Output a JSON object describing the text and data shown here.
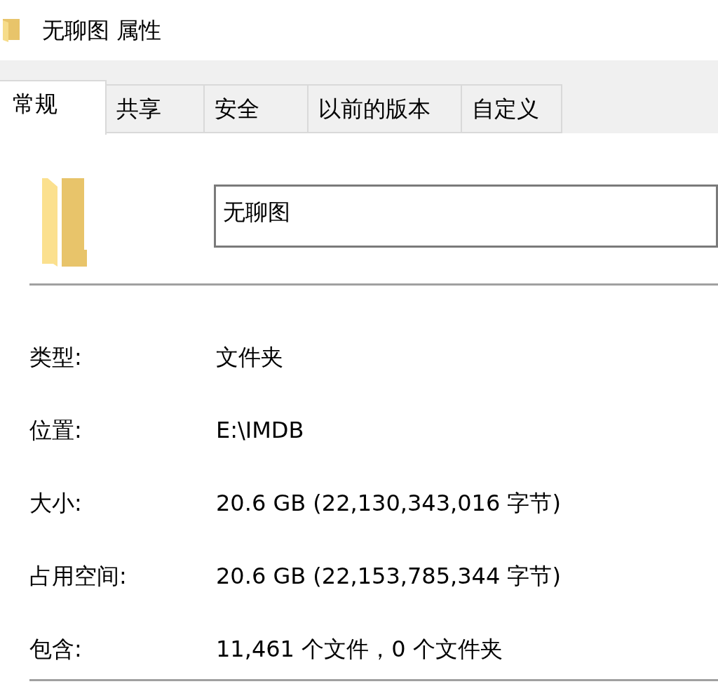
{
  "window": {
    "title": "无聊图 属性"
  },
  "tabs": [
    {
      "label": "常规",
      "selected": true
    },
    {
      "label": "共享",
      "selected": false
    },
    {
      "label": "安全",
      "selected": false
    },
    {
      "label": "以前的版本",
      "selected": false
    },
    {
      "label": "自定义",
      "selected": false
    }
  ],
  "name_field": {
    "value": "无聊图"
  },
  "properties": [
    {
      "label": "类型:",
      "value": "文件夹"
    },
    {
      "label": "位置:",
      "value": "E:\\IMDB"
    },
    {
      "label": "大小:",
      "value": "20.6 GB (22,130,343,016 字节)"
    },
    {
      "label": "占用空间:",
      "value": "20.6 GB (22,153,785,344 字节)"
    },
    {
      "label": "包含:",
      "value": "11,461 个文件，0 个文件夹"
    }
  ]
}
